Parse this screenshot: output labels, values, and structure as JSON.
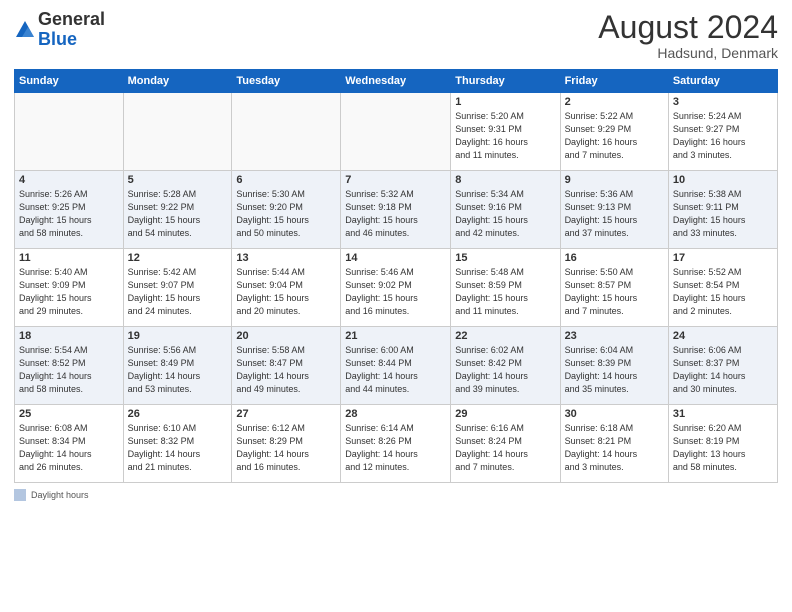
{
  "header": {
    "logo_general": "General",
    "logo_blue": "Blue",
    "month": "August 2024",
    "location": "Hadsund, Denmark"
  },
  "weekdays": [
    "Sunday",
    "Monday",
    "Tuesday",
    "Wednesday",
    "Thursday",
    "Friday",
    "Saturday"
  ],
  "weeks": [
    [
      {
        "day": "",
        "info": ""
      },
      {
        "day": "",
        "info": ""
      },
      {
        "day": "",
        "info": ""
      },
      {
        "day": "",
        "info": ""
      },
      {
        "day": "1",
        "info": "Sunrise: 5:20 AM\nSunset: 9:31 PM\nDaylight: 16 hours\nand 11 minutes."
      },
      {
        "day": "2",
        "info": "Sunrise: 5:22 AM\nSunset: 9:29 PM\nDaylight: 16 hours\nand 7 minutes."
      },
      {
        "day": "3",
        "info": "Sunrise: 5:24 AM\nSunset: 9:27 PM\nDaylight: 16 hours\nand 3 minutes."
      }
    ],
    [
      {
        "day": "4",
        "info": "Sunrise: 5:26 AM\nSunset: 9:25 PM\nDaylight: 15 hours\nand 58 minutes."
      },
      {
        "day": "5",
        "info": "Sunrise: 5:28 AM\nSunset: 9:22 PM\nDaylight: 15 hours\nand 54 minutes."
      },
      {
        "day": "6",
        "info": "Sunrise: 5:30 AM\nSunset: 9:20 PM\nDaylight: 15 hours\nand 50 minutes."
      },
      {
        "day": "7",
        "info": "Sunrise: 5:32 AM\nSunset: 9:18 PM\nDaylight: 15 hours\nand 46 minutes."
      },
      {
        "day": "8",
        "info": "Sunrise: 5:34 AM\nSunset: 9:16 PM\nDaylight: 15 hours\nand 42 minutes."
      },
      {
        "day": "9",
        "info": "Sunrise: 5:36 AM\nSunset: 9:13 PM\nDaylight: 15 hours\nand 37 minutes."
      },
      {
        "day": "10",
        "info": "Sunrise: 5:38 AM\nSunset: 9:11 PM\nDaylight: 15 hours\nand 33 minutes."
      }
    ],
    [
      {
        "day": "11",
        "info": "Sunrise: 5:40 AM\nSunset: 9:09 PM\nDaylight: 15 hours\nand 29 minutes."
      },
      {
        "day": "12",
        "info": "Sunrise: 5:42 AM\nSunset: 9:07 PM\nDaylight: 15 hours\nand 24 minutes."
      },
      {
        "day": "13",
        "info": "Sunrise: 5:44 AM\nSunset: 9:04 PM\nDaylight: 15 hours\nand 20 minutes."
      },
      {
        "day": "14",
        "info": "Sunrise: 5:46 AM\nSunset: 9:02 PM\nDaylight: 15 hours\nand 16 minutes."
      },
      {
        "day": "15",
        "info": "Sunrise: 5:48 AM\nSunset: 8:59 PM\nDaylight: 15 hours\nand 11 minutes."
      },
      {
        "day": "16",
        "info": "Sunrise: 5:50 AM\nSunset: 8:57 PM\nDaylight: 15 hours\nand 7 minutes."
      },
      {
        "day": "17",
        "info": "Sunrise: 5:52 AM\nSunset: 8:54 PM\nDaylight: 15 hours\nand 2 minutes."
      }
    ],
    [
      {
        "day": "18",
        "info": "Sunrise: 5:54 AM\nSunset: 8:52 PM\nDaylight: 14 hours\nand 58 minutes."
      },
      {
        "day": "19",
        "info": "Sunrise: 5:56 AM\nSunset: 8:49 PM\nDaylight: 14 hours\nand 53 minutes."
      },
      {
        "day": "20",
        "info": "Sunrise: 5:58 AM\nSunset: 8:47 PM\nDaylight: 14 hours\nand 49 minutes."
      },
      {
        "day": "21",
        "info": "Sunrise: 6:00 AM\nSunset: 8:44 PM\nDaylight: 14 hours\nand 44 minutes."
      },
      {
        "day": "22",
        "info": "Sunrise: 6:02 AM\nSunset: 8:42 PM\nDaylight: 14 hours\nand 39 minutes."
      },
      {
        "day": "23",
        "info": "Sunrise: 6:04 AM\nSunset: 8:39 PM\nDaylight: 14 hours\nand 35 minutes."
      },
      {
        "day": "24",
        "info": "Sunrise: 6:06 AM\nSunset: 8:37 PM\nDaylight: 14 hours\nand 30 minutes."
      }
    ],
    [
      {
        "day": "25",
        "info": "Sunrise: 6:08 AM\nSunset: 8:34 PM\nDaylight: 14 hours\nand 26 minutes."
      },
      {
        "day": "26",
        "info": "Sunrise: 6:10 AM\nSunset: 8:32 PM\nDaylight: 14 hours\nand 21 minutes."
      },
      {
        "day": "27",
        "info": "Sunrise: 6:12 AM\nSunset: 8:29 PM\nDaylight: 14 hours\nand 16 minutes."
      },
      {
        "day": "28",
        "info": "Sunrise: 6:14 AM\nSunset: 8:26 PM\nDaylight: 14 hours\nand 12 minutes."
      },
      {
        "day": "29",
        "info": "Sunrise: 6:16 AM\nSunset: 8:24 PM\nDaylight: 14 hours\nand 7 minutes."
      },
      {
        "day": "30",
        "info": "Sunrise: 6:18 AM\nSunset: 8:21 PM\nDaylight: 14 hours\nand 3 minutes."
      },
      {
        "day": "31",
        "info": "Sunrise: 6:20 AM\nSunset: 8:19 PM\nDaylight: 13 hours\nand 58 minutes."
      }
    ]
  ],
  "footer": {
    "legend_label": "Daylight hours"
  }
}
